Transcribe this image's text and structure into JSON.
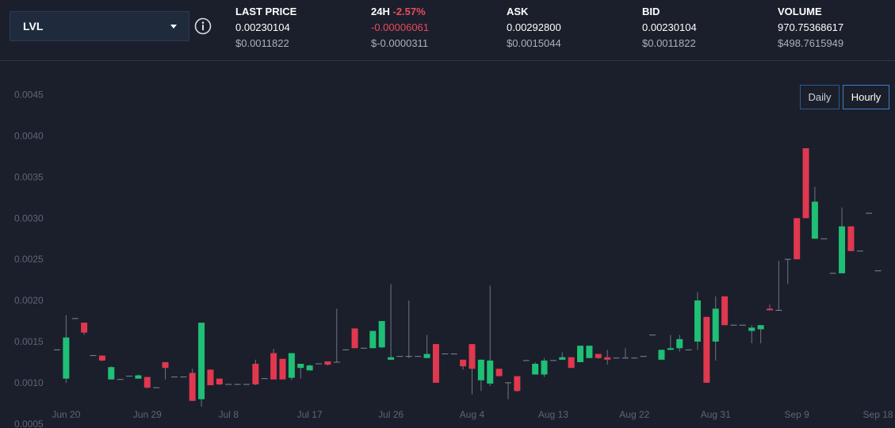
{
  "pair": {
    "label": "LVL"
  },
  "stats": [
    {
      "key": "last-price",
      "head": "LAST PRICE",
      "change": "",
      "value": "0.00230104",
      "usd": "$0.0011822",
      "neg": false
    },
    {
      "key": "24h",
      "head": "24H",
      "change": "-2.57%",
      "value": "-0.00006061",
      "usd": "$-0.0000311",
      "neg": true
    },
    {
      "key": "ask",
      "head": "ASK",
      "change": "",
      "value": "0.00292800",
      "usd": "$0.0015044",
      "neg": false
    },
    {
      "key": "bid",
      "head": "BID",
      "change": "",
      "value": "0.00230104",
      "usd": "$0.0011822",
      "neg": false
    },
    {
      "key": "volume",
      "head": "VOLUME",
      "change": "",
      "value": "970.75368617",
      "usd": "$498.7615949",
      "neg": false
    }
  ],
  "timeframe": {
    "daily": "Daily",
    "hourly": "Hourly",
    "selected": "Hourly"
  },
  "colors": {
    "up": "#1fbf75",
    "down": "#e0384f",
    "neutral": "#7f8796",
    "background": "#1b1f2b"
  },
  "chart_data": {
    "type": "candlestick",
    "x_tick_labels": [
      "Jun 20",
      "Jun 29",
      "Jul 8",
      "Jul 17",
      "Jul 26",
      "Aug 4",
      "Aug 13",
      "Aug 22",
      "Aug 31",
      "Sep 9",
      "Sep 18"
    ],
    "y_tick_labels": [
      "0.0005",
      "0.0010",
      "0.0015",
      "0.0020",
      "0.0025",
      "0.0030",
      "0.0035",
      "0.0040",
      "0.0045"
    ],
    "ylim": [
      0.00045,
      0.0049
    ],
    "xlim": [
      "2018-06-19",
      "2018-09-18"
    ],
    "grid": false,
    "candles": [
      {
        "d": "06-19",
        "o": 0.0014,
        "h": 0.0014,
        "l": 0.0014,
        "c": 0.0014
      },
      {
        "d": "06-20",
        "o": 0.00105,
        "h": 0.00182,
        "l": 0.001,
        "c": 0.00155
      },
      {
        "d": "06-21",
        "o": 0.00178,
        "h": 0.00178,
        "l": 0.00178,
        "c": 0.00178
      },
      {
        "d": "06-22",
        "o": 0.00173,
        "h": 0.00173,
        "l": 0.00158,
        "c": 0.00161
      },
      {
        "d": "06-23",
        "o": 0.00133,
        "h": 0.00133,
        "l": 0.00133,
        "c": 0.00133
      },
      {
        "d": "06-24",
        "o": 0.00133,
        "h": 0.00133,
        "l": 0.00126,
        "c": 0.00127
      },
      {
        "d": "06-25",
        "o": 0.00104,
        "h": 0.0012,
        "l": 0.00104,
        "c": 0.00119
      },
      {
        "d": "06-26",
        "o": 0.00104,
        "h": 0.00104,
        "l": 0.00104,
        "c": 0.00104
      },
      {
        "d": "06-27",
        "o": 0.00108,
        "h": 0.00108,
        "l": 0.00108,
        "c": 0.00108
      },
      {
        "d": "06-28",
        "o": 0.00105,
        "h": 0.0011,
        "l": 0.00105,
        "c": 0.00109
      },
      {
        "d": "06-29",
        "o": 0.00107,
        "h": 0.00107,
        "l": 0.00093,
        "c": 0.00094
      },
      {
        "d": "06-30",
        "o": 0.00094,
        "h": 0.00094,
        "l": 0.00094,
        "c": 0.00094
      },
      {
        "d": "07-01",
        "o": 0.00125,
        "h": 0.00125,
        "l": 0.00104,
        "c": 0.00118
      },
      {
        "d": "07-02",
        "o": 0.00107,
        "h": 0.00107,
        "l": 0.00107,
        "c": 0.00107
      },
      {
        "d": "07-03",
        "o": 0.00107,
        "h": 0.00107,
        "l": 0.00107,
        "c": 0.00107
      },
      {
        "d": "07-04",
        "o": 0.00112,
        "h": 0.00117,
        "l": 0.00078,
        "c": 0.00078
      },
      {
        "d": "07-05",
        "o": 0.0008,
        "h": 0.00173,
        "l": 0.00071,
        "c": 0.00173
      },
      {
        "d": "07-06",
        "o": 0.00116,
        "h": 0.00116,
        "l": 0.00097,
        "c": 0.00097
      },
      {
        "d": "07-07",
        "o": 0.00105,
        "h": 0.00105,
        "l": 0.00097,
        "c": 0.00098
      },
      {
        "d": "07-08",
        "o": 0.00098,
        "h": 0.00098,
        "l": 0.00098,
        "c": 0.00098
      },
      {
        "d": "07-09",
        "o": 0.00098,
        "h": 0.00098,
        "l": 0.00098,
        "c": 0.00098
      },
      {
        "d": "07-10",
        "o": 0.00098,
        "h": 0.00098,
        "l": 0.00098,
        "c": 0.00098
      },
      {
        "d": "07-11",
        "o": 0.00123,
        "h": 0.00128,
        "l": 0.00097,
        "c": 0.00098
      },
      {
        "d": "07-12",
        "o": 0.00105,
        "h": 0.00105,
        "l": 0.00105,
        "c": 0.00105
      },
      {
        "d": "07-13",
        "o": 0.00136,
        "h": 0.00141,
        "l": 0.00104,
        "c": 0.00104
      },
      {
        "d": "07-14",
        "o": 0.00129,
        "h": 0.00129,
        "l": 0.00104,
        "c": 0.00104
      },
      {
        "d": "07-15",
        "o": 0.00106,
        "h": 0.00136,
        "l": 0.00103,
        "c": 0.00136
      },
      {
        "d": "07-16",
        "o": 0.00118,
        "h": 0.00123,
        "l": 0.00105,
        "c": 0.00123
      },
      {
        "d": "07-17",
        "o": 0.00115,
        "h": 0.00122,
        "l": 0.00115,
        "c": 0.00121
      },
      {
        "d": "07-18",
        "o": 0.00123,
        "h": 0.00123,
        "l": 0.00123,
        "c": 0.00123
      },
      {
        "d": "07-19",
        "o": 0.00126,
        "h": 0.00126,
        "l": 0.00121,
        "c": 0.00122
      },
      {
        "d": "07-20",
        "o": 0.00125,
        "h": 0.0019,
        "l": 0.00125,
        "c": 0.00125
      },
      {
        "d": "07-21",
        "o": 0.0014,
        "h": 0.0014,
        "l": 0.0014,
        "c": 0.0014
      },
      {
        "d": "07-22",
        "o": 0.00166,
        "h": 0.00166,
        "l": 0.00142,
        "c": 0.00142
      },
      {
        "d": "07-23",
        "o": 0.00142,
        "h": 0.00142,
        "l": 0.00142,
        "c": 0.00142
      },
      {
        "d": "07-24",
        "o": 0.00142,
        "h": 0.00163,
        "l": 0.00142,
        "c": 0.00163
      },
      {
        "d": "07-25",
        "o": 0.00143,
        "h": 0.00175,
        "l": 0.00142,
        "c": 0.00175
      },
      {
        "d": "07-26",
        "o": 0.00128,
        "h": 0.0022,
        "l": 0.00128,
        "c": 0.00131
      },
      {
        "d": "07-27",
        "o": 0.00132,
        "h": 0.00132,
        "l": 0.00132,
        "c": 0.00132
      },
      {
        "d": "07-28",
        "o": 0.00132,
        "h": 0.002,
        "l": 0.0013,
        "c": 0.00132
      },
      {
        "d": "07-29",
        "o": 0.00132,
        "h": 0.00132,
        "l": 0.00132,
        "c": 0.00132
      },
      {
        "d": "07-30",
        "o": 0.0013,
        "h": 0.00158,
        "l": 0.0013,
        "c": 0.00135
      },
      {
        "d": "07-31",
        "o": 0.00147,
        "h": 0.00147,
        "l": 0.001,
        "c": 0.001
      },
      {
        "d": "08-01",
        "o": 0.00135,
        "h": 0.00135,
        "l": 0.00135,
        "c": 0.00135
      },
      {
        "d": "08-02",
        "o": 0.00135,
        "h": 0.00135,
        "l": 0.00135,
        "c": 0.00135
      },
      {
        "d": "08-03",
        "o": 0.00128,
        "h": 0.00128,
        "l": 0.00116,
        "c": 0.0012
      },
      {
        "d": "08-04",
        "o": 0.00147,
        "h": 0.00147,
        "l": 0.00086,
        "c": 0.00117
      },
      {
        "d": "08-05",
        "o": 0.00103,
        "h": 0.00128,
        "l": 0.0009,
        "c": 0.00128
      },
      {
        "d": "08-06",
        "o": 0.00099,
        "h": 0.00218,
        "l": 0.00096,
        "c": 0.00127
      },
      {
        "d": "08-07",
        "o": 0.00117,
        "h": 0.00117,
        "l": 0.00108,
        "c": 0.00108
      },
      {
        "d": "08-08",
        "o": 0.001,
        "h": 0.001,
        "l": 0.0008,
        "c": 0.001
      },
      {
        "d": "08-09",
        "o": 0.00108,
        "h": 0.00108,
        "l": 0.00089,
        "c": 0.0009
      },
      {
        "d": "08-10",
        "o": 0.00127,
        "h": 0.00127,
        "l": 0.00127,
        "c": 0.00127
      },
      {
        "d": "08-11",
        "o": 0.0011,
        "h": 0.00125,
        "l": 0.0011,
        "c": 0.00123
      },
      {
        "d": "08-12",
        "o": 0.0011,
        "h": 0.0013,
        "l": 0.00107,
        "c": 0.00127
      },
      {
        "d": "08-13",
        "o": 0.00127,
        "h": 0.00127,
        "l": 0.00127,
        "c": 0.00127
      },
      {
        "d": "08-14",
        "o": 0.00128,
        "h": 0.00137,
        "l": 0.00128,
        "c": 0.00131
      },
      {
        "d": "08-15",
        "o": 0.00131,
        "h": 0.00131,
        "l": 0.00118,
        "c": 0.00118
      },
      {
        "d": "08-16",
        "o": 0.00125,
        "h": 0.00145,
        "l": 0.00125,
        "c": 0.00145
      },
      {
        "d": "08-17",
        "o": 0.0013,
        "h": 0.00145,
        "l": 0.0013,
        "c": 0.00145
      },
      {
        "d": "08-18",
        "o": 0.00135,
        "h": 0.00135,
        "l": 0.00129,
        "c": 0.0013
      },
      {
        "d": "08-19",
        "o": 0.00131,
        "h": 0.0014,
        "l": 0.00122,
        "c": 0.00128
      },
      {
        "d": "08-20",
        "o": 0.0013,
        "h": 0.0013,
        "l": 0.0013,
        "c": 0.0013
      },
      {
        "d": "08-21",
        "o": 0.0013,
        "h": 0.00142,
        "l": 0.0013,
        "c": 0.0013
      },
      {
        "d": "08-22",
        "o": 0.0013,
        "h": 0.0013,
        "l": 0.0013,
        "c": 0.0013
      },
      {
        "d": "08-23",
        "o": 0.00132,
        "h": 0.00132,
        "l": 0.00132,
        "c": 0.00132
      },
      {
        "d": "08-24",
        "o": 0.00158,
        "h": 0.00158,
        "l": 0.00158,
        "c": 0.00158
      },
      {
        "d": "08-25",
        "o": 0.00128,
        "h": 0.0014,
        "l": 0.00128,
        "c": 0.0014
      },
      {
        "d": "08-26",
        "o": 0.0014,
        "h": 0.00158,
        "l": 0.0014,
        "c": 0.00142
      },
      {
        "d": "08-27",
        "o": 0.00142,
        "h": 0.00158,
        "l": 0.00138,
        "c": 0.00153
      },
      {
        "d": "08-28",
        "o": 0.0014,
        "h": 0.0014,
        "l": 0.0014,
        "c": 0.0014
      },
      {
        "d": "08-29",
        "o": 0.0015,
        "h": 0.0021,
        "l": 0.0014,
        "c": 0.002
      },
      {
        "d": "08-30",
        "o": 0.0018,
        "h": 0.0018,
        "l": 0.001,
        "c": 0.001
      },
      {
        "d": "08-31",
        "o": 0.0015,
        "h": 0.00205,
        "l": 0.00127,
        "c": 0.0019
      },
      {
        "d": "09-01",
        "o": 0.00205,
        "h": 0.00205,
        "l": 0.0017,
        "c": 0.0017
      },
      {
        "d": "09-02",
        "o": 0.0017,
        "h": 0.0017,
        "l": 0.0017,
        "c": 0.0017
      },
      {
        "d": "09-03",
        "o": 0.0017,
        "h": 0.0017,
        "l": 0.0017,
        "c": 0.0017
      },
      {
        "d": "09-04",
        "o": 0.00163,
        "h": 0.0017,
        "l": 0.00148,
        "c": 0.00167
      },
      {
        "d": "09-05",
        "o": 0.00165,
        "h": 0.0017,
        "l": 0.00148,
        "c": 0.0017
      },
      {
        "d": "09-06",
        "o": 0.0019,
        "h": 0.00195,
        "l": 0.00188,
        "c": 0.00188
      },
      {
        "d": "09-07",
        "o": 0.00188,
        "h": 0.00248,
        "l": 0.00188,
        "c": 0.00188
      },
      {
        "d": "09-08",
        "o": 0.0025,
        "h": 0.0025,
        "l": 0.0022,
        "c": 0.0025
      },
      {
        "d": "09-09",
        "o": 0.003,
        "h": 0.003,
        "l": 0.0025,
        "c": 0.0025
      },
      {
        "d": "09-10",
        "o": 0.00385,
        "h": 0.00385,
        "l": 0.003,
        "c": 0.003
      },
      {
        "d": "09-11",
        "o": 0.00275,
        "h": 0.00338,
        "l": 0.00275,
        "c": 0.0032
      },
      {
        "d": "09-12",
        "o": 0.00275,
        "h": 0.00275,
        "l": 0.00275,
        "c": 0.00275
      },
      {
        "d": "09-13",
        "o": 0.00233,
        "h": 0.00233,
        "l": 0.00233,
        "c": 0.00233
      },
      {
        "d": "09-14",
        "o": 0.00233,
        "h": 0.00313,
        "l": 0.00233,
        "c": 0.0029
      },
      {
        "d": "09-15",
        "o": 0.0029,
        "h": 0.0029,
        "l": 0.0026,
        "c": 0.0026
      },
      {
        "d": "09-16",
        "o": 0.0026,
        "h": 0.0026,
        "l": 0.0026,
        "c": 0.0026
      },
      {
        "d": "09-17",
        "o": 0.00306,
        "h": 0.00306,
        "l": 0.00306,
        "c": 0.00306
      },
      {
        "d": "09-18",
        "o": 0.00236,
        "h": 0.00236,
        "l": 0.00236,
        "c": 0.00236
      }
    ]
  }
}
